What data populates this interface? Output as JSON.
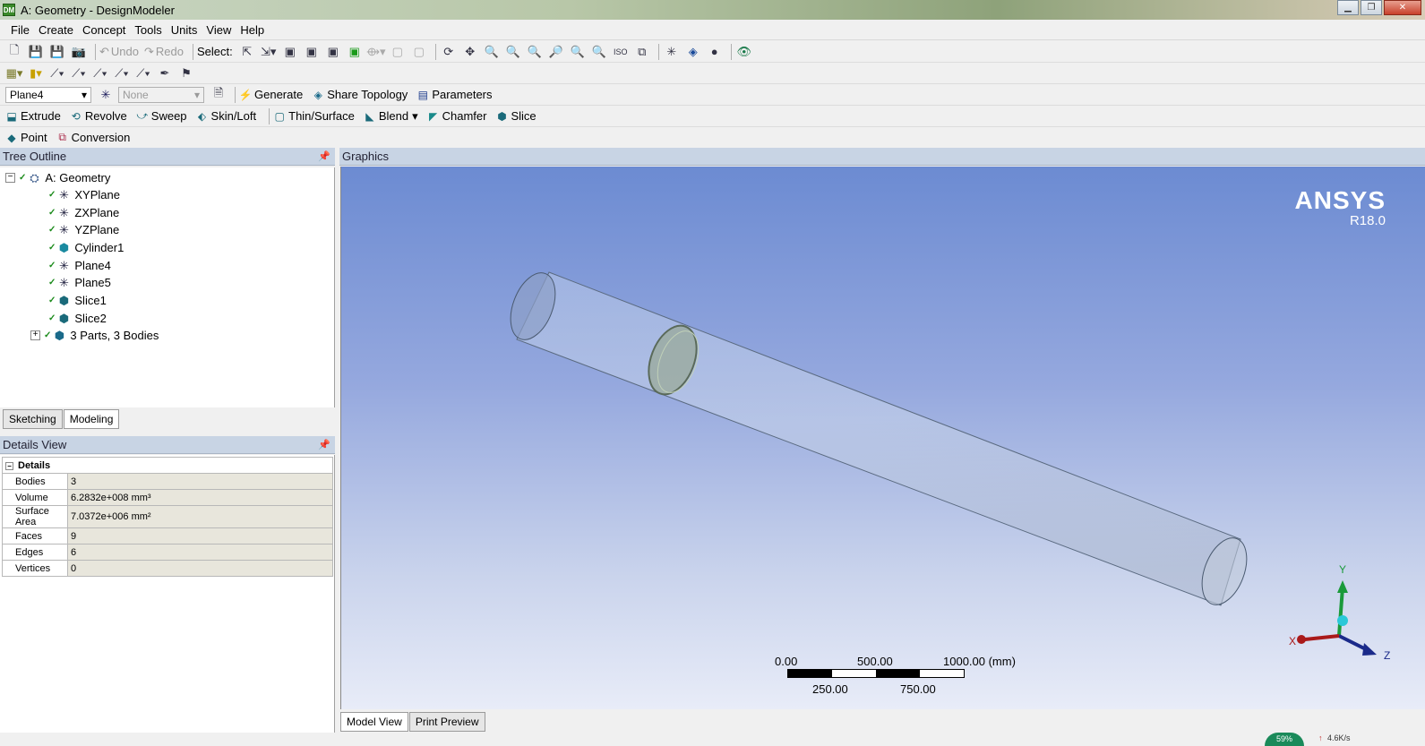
{
  "window": {
    "app_icon": "DM",
    "title": "A: Geometry - DesignModeler"
  },
  "menu": [
    "File",
    "Create",
    "Concept",
    "Tools",
    "Units",
    "View",
    "Help"
  ],
  "toolbar1": {
    "undo": "Undo",
    "redo": "Redo",
    "select_label": "Select:"
  },
  "toolbar3": {
    "plane_combo": "Plane4",
    "sketch_combo": "None",
    "generate": "Generate",
    "share_topology": "Share Topology",
    "parameters": "Parameters"
  },
  "toolbar4": {
    "extrude": "Extrude",
    "revolve": "Revolve",
    "sweep": "Sweep",
    "skin_loft": "Skin/Loft",
    "thin_surface": "Thin/Surface",
    "blend": "Blend",
    "chamfer": "Chamfer",
    "slice": "Slice"
  },
  "toolbar5": {
    "point": "Point",
    "conversion": "Conversion"
  },
  "tree_outline": {
    "title": "Tree Outline",
    "root": "A: Geometry",
    "items": [
      "XYPlane",
      "ZXPlane",
      "YZPlane",
      "Cylinder1",
      "Plane4",
      "Plane5",
      "Slice1",
      "Slice2",
      "3 Parts, 3 Bodies"
    ]
  },
  "mode_tabs": [
    "Sketching",
    "Modeling"
  ],
  "details_view": {
    "title": "Details View",
    "section": "Details",
    "rows": [
      {
        "label": "Bodies",
        "value": "3"
      },
      {
        "label": "Volume",
        "value": "6.2832e+008 mm³"
      },
      {
        "label": "Surface Area",
        "value": "7.0372e+006 mm²"
      },
      {
        "label": "Faces",
        "value": "9"
      },
      {
        "label": "Edges",
        "value": "6"
      },
      {
        "label": "Vertices",
        "value": "0"
      }
    ]
  },
  "graphics": {
    "title": "Graphics",
    "brand": "ANSYS",
    "version": "R18.0",
    "scale": {
      "t0": "0.00",
      "t500": "500.00",
      "t1000": "1000.00 (mm)",
      "t250": "250.00",
      "t750": "750.00"
    },
    "axes": {
      "x": "X",
      "y": "Y",
      "z": "Z"
    }
  },
  "view_tabs": [
    "Model View",
    "Print Preview"
  ],
  "status": {
    "progress": "59%",
    "speed": "4.6K/s"
  }
}
